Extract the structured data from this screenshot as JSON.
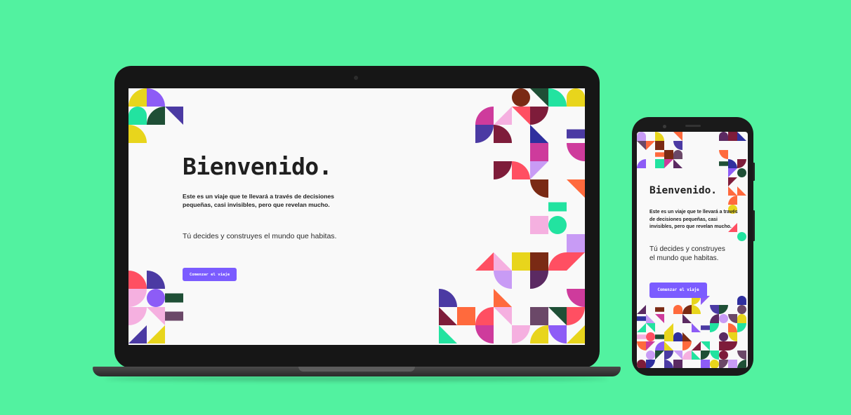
{
  "palette": {
    "background": "#52f2a0",
    "accent": "#7b5cff",
    "shapes": [
      "#ff6a3d",
      "#e8d51c",
      "#22e3a0",
      "#2f2f9e",
      "#ce3b9c",
      "#f5b0e0",
      "#7e1c3a",
      "#8d5cf6",
      "#6b4868",
      "#7a2a14",
      "#1f4f36",
      "#c89bf5",
      "#5b2a62",
      "#ff4f62",
      "#4b3aa3"
    ]
  },
  "welcome": {
    "title": "Bienvenido.",
    "intro": "Este es un viaje que te llevará a través de decisiones pequeñas, casi invisibles, pero que revelan mucho.",
    "tagline": "Tú decides y construyes el mundo que habitas.",
    "cta_label": "Comenzar el viaje"
  }
}
